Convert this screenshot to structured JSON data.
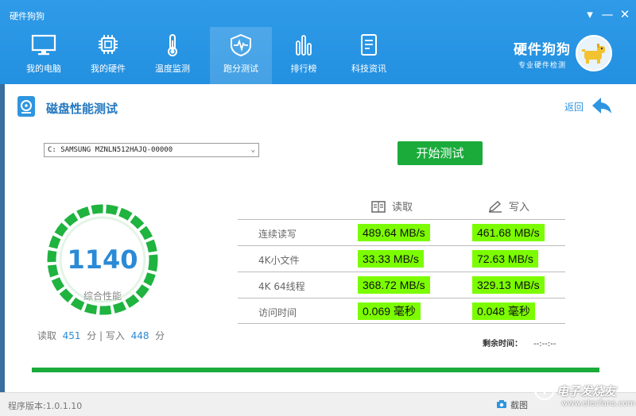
{
  "window": {
    "title": "硬件狗狗"
  },
  "nav": {
    "tabs": [
      {
        "label": "我的电脑"
      },
      {
        "label": "我的硬件"
      },
      {
        "label": "温度监测"
      },
      {
        "label": "跑分测试"
      },
      {
        "label": "排行榜"
      },
      {
        "label": "科技资讯"
      }
    ],
    "active_tab": "跑分测试"
  },
  "brand": {
    "name": "硬件狗狗",
    "slogan": "专业硬件检测"
  },
  "page": {
    "title": "磁盘性能测试",
    "back_label": "返回"
  },
  "drive": {
    "selected": "C: SAMSUNG MZNLN512HAJQ-00000"
  },
  "start_button": {
    "label": "开始测试"
  },
  "score": {
    "total": "1140",
    "label": "综合性能",
    "read_label": "读取",
    "read_score": "451",
    "write_label": "写入",
    "write_score": "448",
    "unit": "分",
    "separator": "|"
  },
  "results": {
    "read_header": "读取",
    "write_header": "写入",
    "rows": [
      {
        "label": "连续读写",
        "read": "489.64 MB/s",
        "write": "461.68 MB/s"
      },
      {
        "label": "4K小文件",
        "read": "33.33 MB/s",
        "write": "72.63 MB/s"
      },
      {
        "label": "4K 64线程",
        "read": "368.72 MB/s",
        "write": "329.13 MB/s"
      },
      {
        "label": "访问时间",
        "read": "0.069 毫秒",
        "write": "0.048 毫秒"
      }
    ]
  },
  "remaining": {
    "label": "剩余时间：",
    "value": "--:--:--"
  },
  "progress": {
    "percent": 100
  },
  "status_bar": {
    "version": "程序版本:1.0.1.10",
    "screenshot_label": "截图"
  },
  "watermark": {
    "text": "电子发烧友",
    "url": "www.elecfans.com"
  },
  "colors": {
    "header": "#2390e0",
    "accent": "#1aab3b",
    "highlight": "#7cfc00",
    "score": "#2a8ad6"
  }
}
